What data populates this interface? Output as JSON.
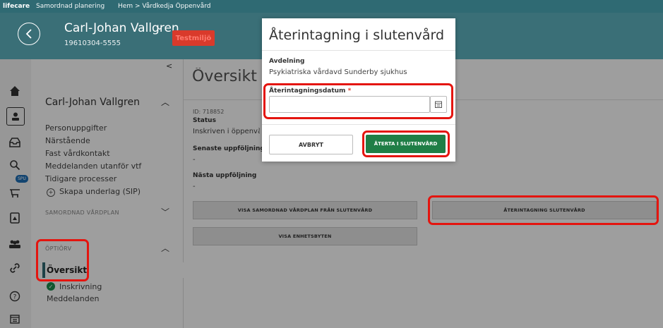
{
  "topbar": {
    "brand": "lifecare",
    "module": "Samordnad planering",
    "breadcrumb": "Hem > Vårdkedja Öppenvård"
  },
  "header": {
    "patient_name": "Carl-Johan Vallgren",
    "personnummer": "19610304-5555",
    "env_badge": "Testmiljö"
  },
  "left_icons": [
    "home-icon",
    "patient-icon",
    "inbox-icon",
    "search-icon",
    "cart-icon",
    "document-icon",
    "group-icon",
    "link-icon",
    "help-icon",
    "calendar-icon"
  ],
  "spu_badge": "SPU",
  "sidepanel": {
    "patient_name": "Carl-Johan Vallgren",
    "links": [
      "Personuppgifter",
      "Närstående",
      "Fast vårdkontakt",
      "Meddelanden utanför vtf",
      "Tidigare processer"
    ],
    "create_sip": "Skapa underlag (SIP)",
    "section_plan": "SAMORDNAD VÅRDPLAN",
    "section_open": "ÖPTIÖRV",
    "active_item": "Översikt",
    "sub_items": [
      "Inskrivning",
      "Meddelanden"
    ]
  },
  "main": {
    "title": "Översikt Ö",
    "id_line": "ID: 718852",
    "status_label": "Status",
    "status_value": "Inskriven i öppenvård",
    "latest_label": "Senaste uppföljning",
    "latest_value": "-",
    "next_label": "Nästa uppföljning",
    "next_value": "-",
    "btn_show_plan": "VISA SAMORDNAD VÅRDPLAN FRÅN SLUTENVÅRD",
    "btn_readmission": "ÅTERINTAGNING SLUTENVÅRD",
    "btn_unit_changes": "VISA ENHETSBYTEN"
  },
  "modal": {
    "title": "Återintagning i slutenvård",
    "dept_label": "Avdelning",
    "dept_value": "Psykiatriska vårdavd Sunderby sjukhus",
    "date_label": "Återintagningsdatum",
    "required_mark": "*",
    "date_value": "",
    "cancel_label": "AVBRYT",
    "confirm_label": "ÅTERTA I SLUTENVÅRD"
  }
}
